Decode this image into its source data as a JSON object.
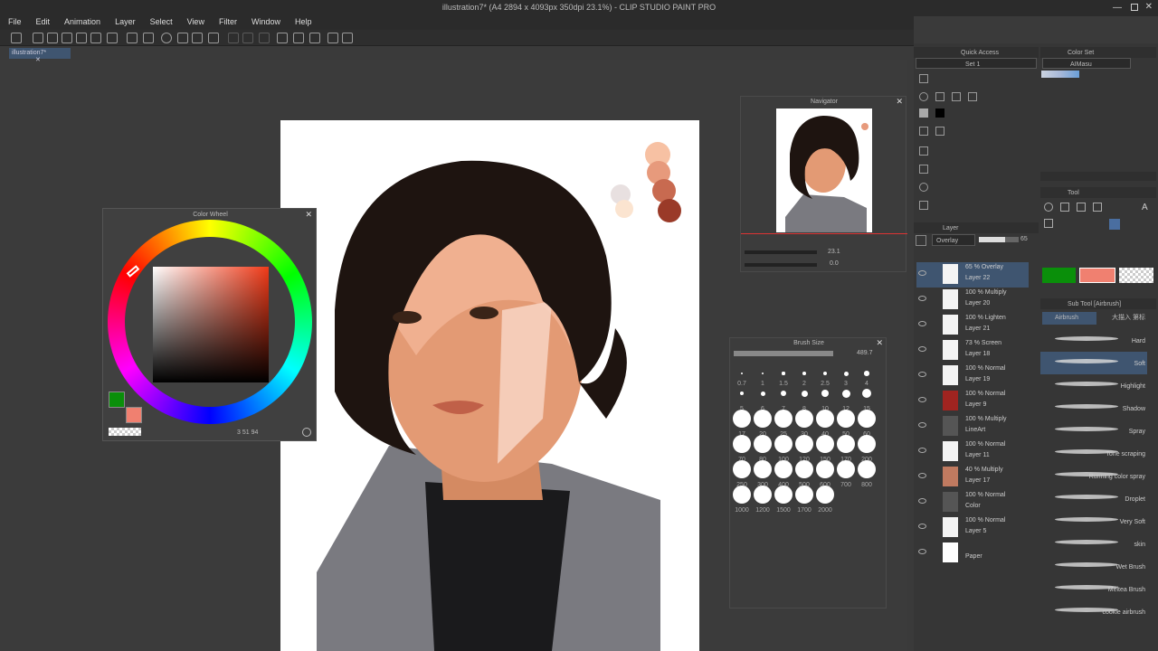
{
  "window": {
    "title": "illustration7* (A4 2894 x 4093px 350dpi 23.1%) - CLIP STUDIO PAINT PRO"
  },
  "menu": [
    "File",
    "Edit",
    "Animation",
    "Layer",
    "Select",
    "View",
    "Filter",
    "Window",
    "Help"
  ],
  "doc_tab": {
    "label": "illustration7*"
  },
  "color_wheel": {
    "title": "Color Wheel",
    "main_color": "#0a8f0a",
    "sub_color": "#f08070",
    "readout": "3   51   94"
  },
  "navigator": {
    "title": "Navigator",
    "zoom": "23.1",
    "rotation": "0.0"
  },
  "brush_size": {
    "title": "Brush Size",
    "value": "489.7",
    "sizes": [
      "0.7",
      "1",
      "1.5",
      "2",
      "2.5",
      "3",
      "4",
      "5",
      "6",
      "7",
      "8",
      "10",
      "12",
      "15",
      "17",
      "20",
      "25",
      "30",
      "40",
      "50",
      "60",
      "70",
      "80",
      "100",
      "120",
      "150",
      "170",
      "200",
      "250",
      "300",
      "400",
      "500",
      "600",
      "700",
      "800",
      "1000",
      "1200",
      "1500",
      "1700",
      "2000"
    ]
  },
  "quick_access": {
    "title": "Quick Access",
    "set": "Set 1"
  },
  "color_set": {
    "title": "Color Set",
    "set": "AIMasu"
  },
  "tool": {
    "title": "Tool"
  },
  "layer_panel": {
    "title": "Layer",
    "blend": "Overlay",
    "opacity": "65"
  },
  "layers": [
    {
      "mode": "65 % Overlay",
      "name": "Layer 22",
      "selected": true,
      "thumb": "#f4f4f4"
    },
    {
      "mode": "100 % Multiply",
      "name": "Layer 20",
      "thumb": "#f4f4f4"
    },
    {
      "mode": "100 % Lighten",
      "name": "Layer 21",
      "thumb": "#f4f4f4"
    },
    {
      "mode": "73 % Screen",
      "name": "Layer 18",
      "thumb": "#f4f4f4"
    },
    {
      "mode": "100 % Normal",
      "name": "Layer 19",
      "thumb": "#f4f4f4"
    },
    {
      "mode": "100 % Normal",
      "name": "Layer 9",
      "thumb": "#a02420"
    },
    {
      "mode": "100 % Multiply",
      "name": "LineArt",
      "thumb": "#555"
    },
    {
      "mode": "100 % Normal",
      "name": "Layer 11",
      "thumb": "#f4f4f4"
    },
    {
      "mode": "40 % Multiply",
      "name": "Layer 17",
      "thumb": "#c07a60"
    },
    {
      "mode": "100 % Normal",
      "name": "Color",
      "thumb": "#555"
    },
    {
      "mode": "100 % Normal",
      "name": "Layer 5",
      "thumb": "#f4f4f4"
    },
    {
      "mode": "",
      "name": "Paper",
      "thumb": "#ffffff"
    }
  ],
  "sub_tool": {
    "title": "Sub Tool [Airbrush]",
    "tab1": "Airbrush",
    "tab2": "大描入 第标",
    "main": "#0a8f0a",
    "sub": "#f08070"
  },
  "brushes": [
    "Hard",
    "Soft",
    "Highlight",
    "Shadow",
    "Spray",
    "Tone scraping",
    "Running color spray",
    "Droplet",
    "Very Soft",
    "skin",
    "Wet Brush",
    "Meltea Brush",
    "cookie airbrush"
  ]
}
